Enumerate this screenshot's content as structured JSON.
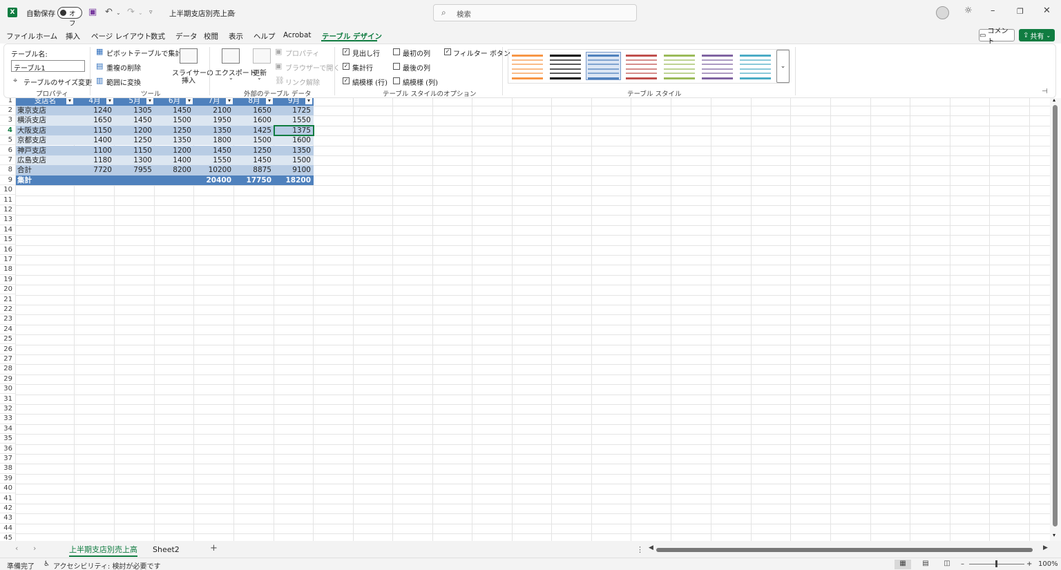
{
  "titlebar": {
    "app_logo": "X",
    "autosave_label": "自動保存",
    "autosave_toggle": "オフ",
    "document_title": "上半期支店別売上高",
    "search_placeholder": "検索",
    "icons": [
      "save-icon",
      "undo-icon",
      "redo-icon",
      "customize-icon",
      "search-icon",
      "account-icon",
      "idea-icon",
      "minimize-icon",
      "restore-icon",
      "close-icon"
    ]
  },
  "menu": {
    "tabs": [
      "ファイル",
      "ホーム",
      "挿入",
      "ページ レイアウト",
      "数式",
      "データ",
      "校閲",
      "表示",
      "ヘルプ",
      "Acrobat",
      "テーブル デザイン"
    ],
    "active_tab": "テーブル デザイン",
    "comment_label": "コメント",
    "share_label": "共有"
  },
  "ribbon": {
    "properties": {
      "table_name_label": "テーブル名:",
      "table_name_value": "テーブル1",
      "resize_label": "テーブルのサイズ変更",
      "group_label": "プロパティ"
    },
    "tools": {
      "pivot_label": "ピボットテーブルで集計",
      "remove_dup_label": "重複の削除",
      "convert_label": "範囲に変換",
      "slicer_label_1": "スライサーの",
      "slicer_label_2": "挿入",
      "group_label": "ツール"
    },
    "external": {
      "export_label": "エクスポート",
      "refresh_label": "更新",
      "properties_label": "プロパティ",
      "browser_label": "ブラウザーで開く",
      "unlink_label": "リンク解除",
      "group_label": "外部のテーブル データ"
    },
    "style_options": {
      "header_row": "見出し行",
      "total_row": "集計行",
      "banded_rows": "縞模様 (行)",
      "first_column": "最初の列",
      "last_column": "最後の列",
      "banded_columns": "縞模様 (列)",
      "filter_button": "フィルター ボタン",
      "header_row_checked": true,
      "total_row_checked": true,
      "banded_rows_checked": true,
      "first_column_checked": false,
      "last_column_checked": false,
      "banded_columns_checked": false,
      "filter_button_checked": true,
      "group_label": "テーブル スタイルのオプション"
    },
    "styles": {
      "group_label": "テーブル スタイル",
      "colors": [
        "#f79646",
        "#000000",
        "#4f81bd",
        "#c0504d",
        "#9bbb59",
        "#8064a2",
        "#4bacc6"
      ],
      "selected_index": 2
    }
  },
  "sheet": {
    "row_count_visible": 45,
    "selected_row": 4,
    "table": {
      "headers": [
        "支店名",
        "4月",
        "5月",
        "6月",
        "7月",
        "8月",
        "9月"
      ],
      "rows": [
        [
          "東京支店",
          "1240",
          "1305",
          "1450",
          "2100",
          "1650",
          "1725"
        ],
        [
          "横浜支店",
          "1650",
          "1450",
          "1500",
          "1950",
          "1600",
          "1550"
        ],
        [
          "大阪支店",
          "1150",
          "1200",
          "1250",
          "1350",
          "1425",
          "1375"
        ],
        [
          "京都支店",
          "1400",
          "1250",
          "1350",
          "1800",
          "1500",
          "1600"
        ],
        [
          "神戸支店",
          "1100",
          "1150",
          "1200",
          "1450",
          "1250",
          "1350"
        ],
        [
          "広島支店",
          "1180",
          "1300",
          "1400",
          "1550",
          "1450",
          "1500"
        ],
        [
          "合計",
          "7720",
          "7955",
          "8200",
          "10200",
          "8875",
          "9100"
        ]
      ],
      "total_row": [
        "集計",
        "",
        "",
        "",
        "20400",
        "17750",
        "18200"
      ]
    }
  },
  "sheet_tabs": {
    "tabs": [
      "上半期支店別売上高",
      "Sheet2"
    ],
    "active": "上半期支店別売上高",
    "add_label": "+"
  },
  "status": {
    "ready": "準備完了",
    "accessibility": "アクセシビリティ: 検討が必要です",
    "zoom": "100%"
  }
}
